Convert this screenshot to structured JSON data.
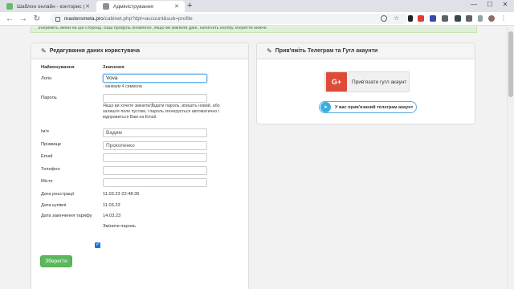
{
  "browser": {
    "tabs": [
      {
        "title": "Шаблон онлайн - конторис (н...",
        "active": false
      },
      {
        "title": "Адміністрування",
        "active": true
      }
    ],
    "new_tab": "+",
    "window_controls": {
      "minimize": "—",
      "maximize": "☐",
      "close": "✕"
    },
    "nav": {
      "back": "←",
      "forward": "→",
      "reload": "↻"
    },
    "url_host": "mastersmeta.pro",
    "url_path": "/cabinet.php?dpt=account&sub=profile"
  },
  "alert": {
    "text": "Збережіть зміни на цій сторінці. Ваш профіль оновлено, якщо ви змінили дані, натисніть кнопку зберегти нижче."
  },
  "profile_panel": {
    "title": "Редагування даних користувача",
    "col_name": "Найменування",
    "col_value": "Значення",
    "login_label": "Логін",
    "login_value": "Vova",
    "login_hint": "- мінімум 4 символи",
    "password_label": "Пароль",
    "password_value": "",
    "password_hint": "Якщо ви хочете змінити/задати пароль, впишіть новий, або залиште поле пустим, і пароль згенерується автоматично і відправиться Вам на Email.",
    "name_label": "Ім'я",
    "name_value": "Вадим",
    "surname_label": "Прізвище",
    "surname_value": "Прокопенко",
    "email_label": "Email",
    "email_value": "",
    "phone_label": "Телефон",
    "phone_value": "",
    "city_label": "Місто",
    "city_value": "",
    "reg_date_label": "Дата реєстрації",
    "reg_date_value": "11.03.23 22:48:36",
    "purchase_date_label": "Дата купівлі",
    "purchase_date_value": "11.03.23",
    "tariff_end_label": "Дата закінчення тарифу",
    "tariff_end_value": "14.03.23",
    "change_password_label": "Змінити пароль",
    "change_password_checked": true,
    "save_label": "Зберегти"
  },
  "social_panel": {
    "title": "Прив'яжіть Телеграм та Гугл акаунти",
    "google_button": "Прив'язати гугл акаунт",
    "google_icon_text": "G+",
    "telegram_button": "У вас прив'язаний телеграм акаунт"
  },
  "colors": {
    "save_green": "#5cb85c",
    "google_red": "#dd4b39",
    "telegram_blue": "#37aee2"
  }
}
